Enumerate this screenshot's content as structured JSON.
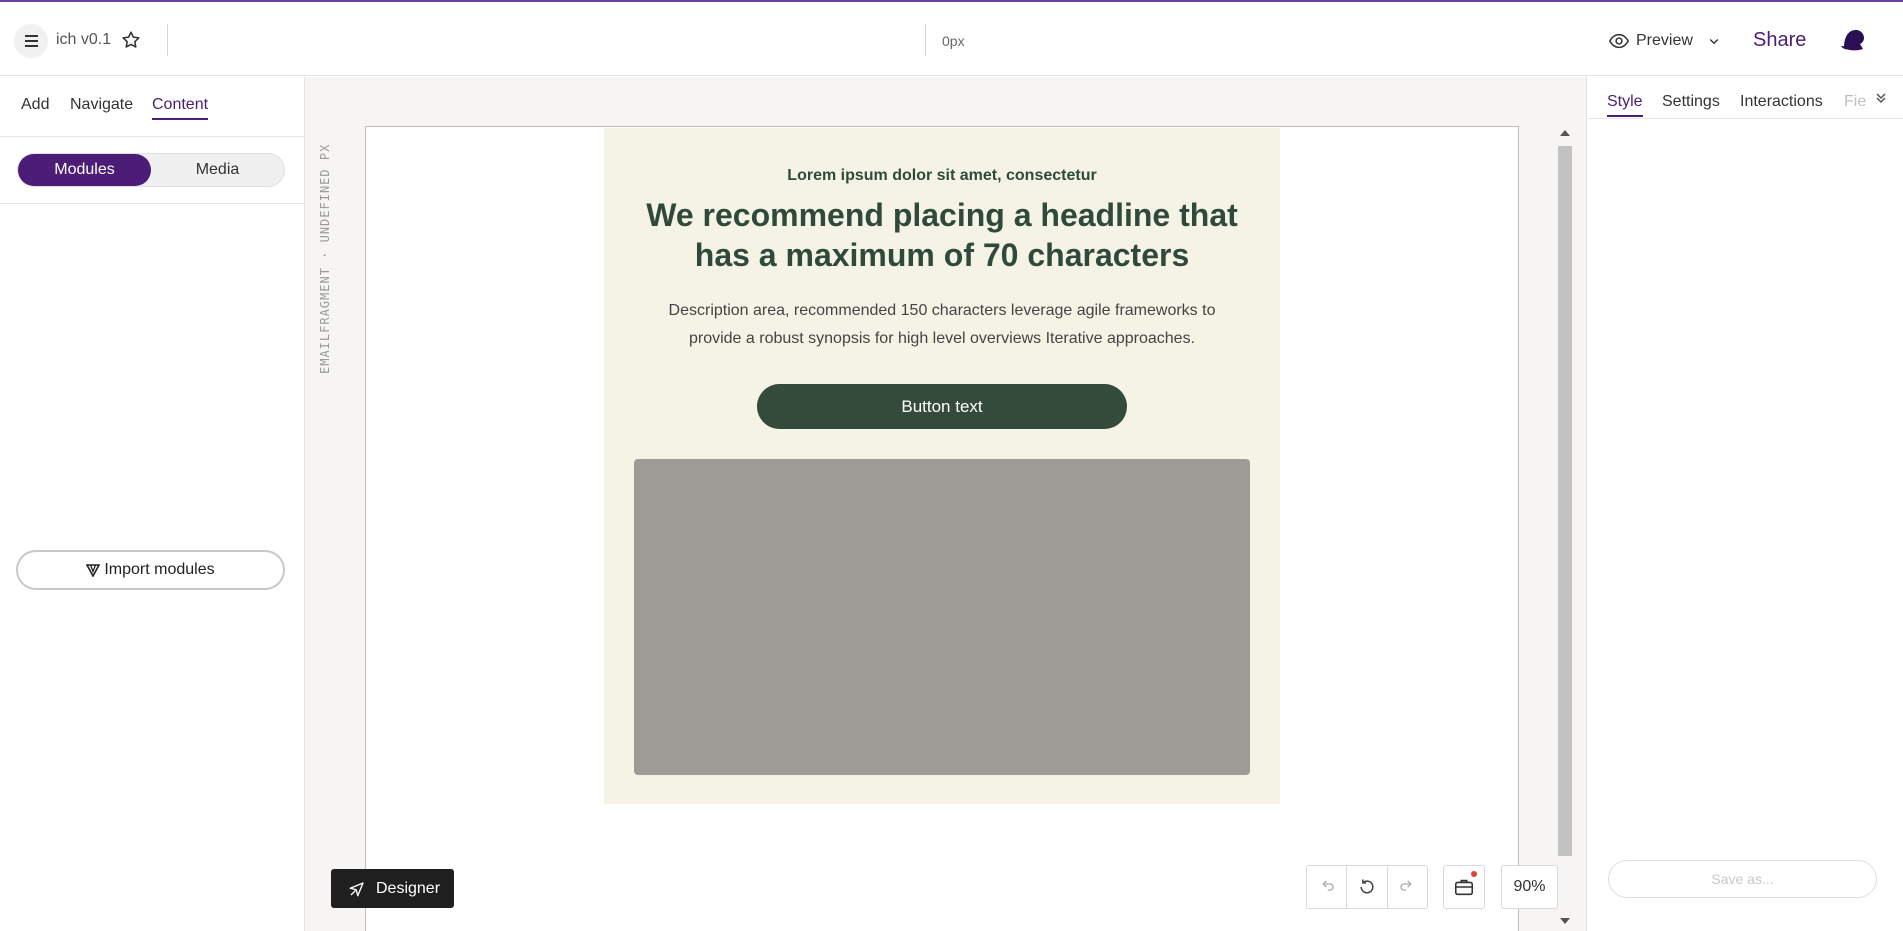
{
  "header": {
    "app_title": "ich v0.1",
    "width_readout": "0px",
    "preview_label": "Preview",
    "share_label": "Share"
  },
  "left_panel": {
    "tabs": [
      {
        "label": "Add",
        "active": false
      },
      {
        "label": "Navigate",
        "active": false
      },
      {
        "label": "Content",
        "active": true
      }
    ],
    "segments": [
      {
        "label": "Modules",
        "active": true
      },
      {
        "label": "Media",
        "active": false
      }
    ],
    "import_label": "Import modules"
  },
  "canvas": {
    "fragment_label": "EMAILFRAGMENT · UNDEFINED PX",
    "email": {
      "eyebrow": "Lorem ipsum dolor sit amet, consectetur",
      "headline": "We recommend placing a headline that has a maximum of 70 characters",
      "description": "Description area, recommended 150 characters leverage agile frameworks to provide a robust synopsis for high level overviews Iterative approaches.",
      "button_label": "Button text"
    },
    "designer_label": "Designer",
    "zoom": "90%"
  },
  "right_panel": {
    "tabs": [
      {
        "label": "Style",
        "active": true
      },
      {
        "label": "Settings",
        "active": false
      },
      {
        "label": "Interactions",
        "active": false
      },
      {
        "label": "Fie",
        "active": false
      }
    ],
    "save_as_label": "Save as..."
  },
  "colors": {
    "accent": "#4b1d76",
    "email_background": "#f5f3e5",
    "email_text": "#2f4a3a",
    "cta_background": "#344b3c",
    "image_placeholder": "#9e9b96",
    "notification_dot": "#e0433a"
  },
  "icons": [
    "menu-icon",
    "star-icon",
    "eye-icon",
    "chevron-down-icon",
    "avatar-icon",
    "import-icon",
    "send-icon",
    "undo-icon",
    "reset-icon",
    "redo-icon",
    "briefcase-icon",
    "double-chevron-down-icon"
  ]
}
